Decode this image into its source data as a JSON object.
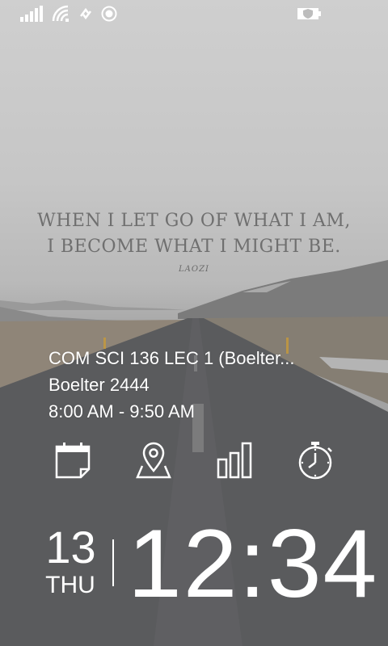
{
  "status_bar": {
    "icons": [
      "signal-bars-icon",
      "wifi-icon",
      "data-sync-icon",
      "location-icon",
      "battery-saver-icon"
    ]
  },
  "quote": {
    "line1": "WHEN I LET GO OF WHAT I AM,",
    "line2": "I BECOME WHAT I MIGHT BE.",
    "author": "LAOZI"
  },
  "event": {
    "title": "COM SCI 136 LEC 1 (Boelter...",
    "location": "Boelter 2444",
    "time": "8:00 AM - 9:50 AM"
  },
  "quick_actions": [
    "calendar-icon",
    "map-pin-icon",
    "bar-chart-icon",
    "stopwatch-icon"
  ],
  "clock": {
    "day": "13",
    "weekday": "THU",
    "time": "12:34"
  },
  "colors": {
    "text": "#ffffff",
    "quote_text": "#6f6f6f"
  }
}
